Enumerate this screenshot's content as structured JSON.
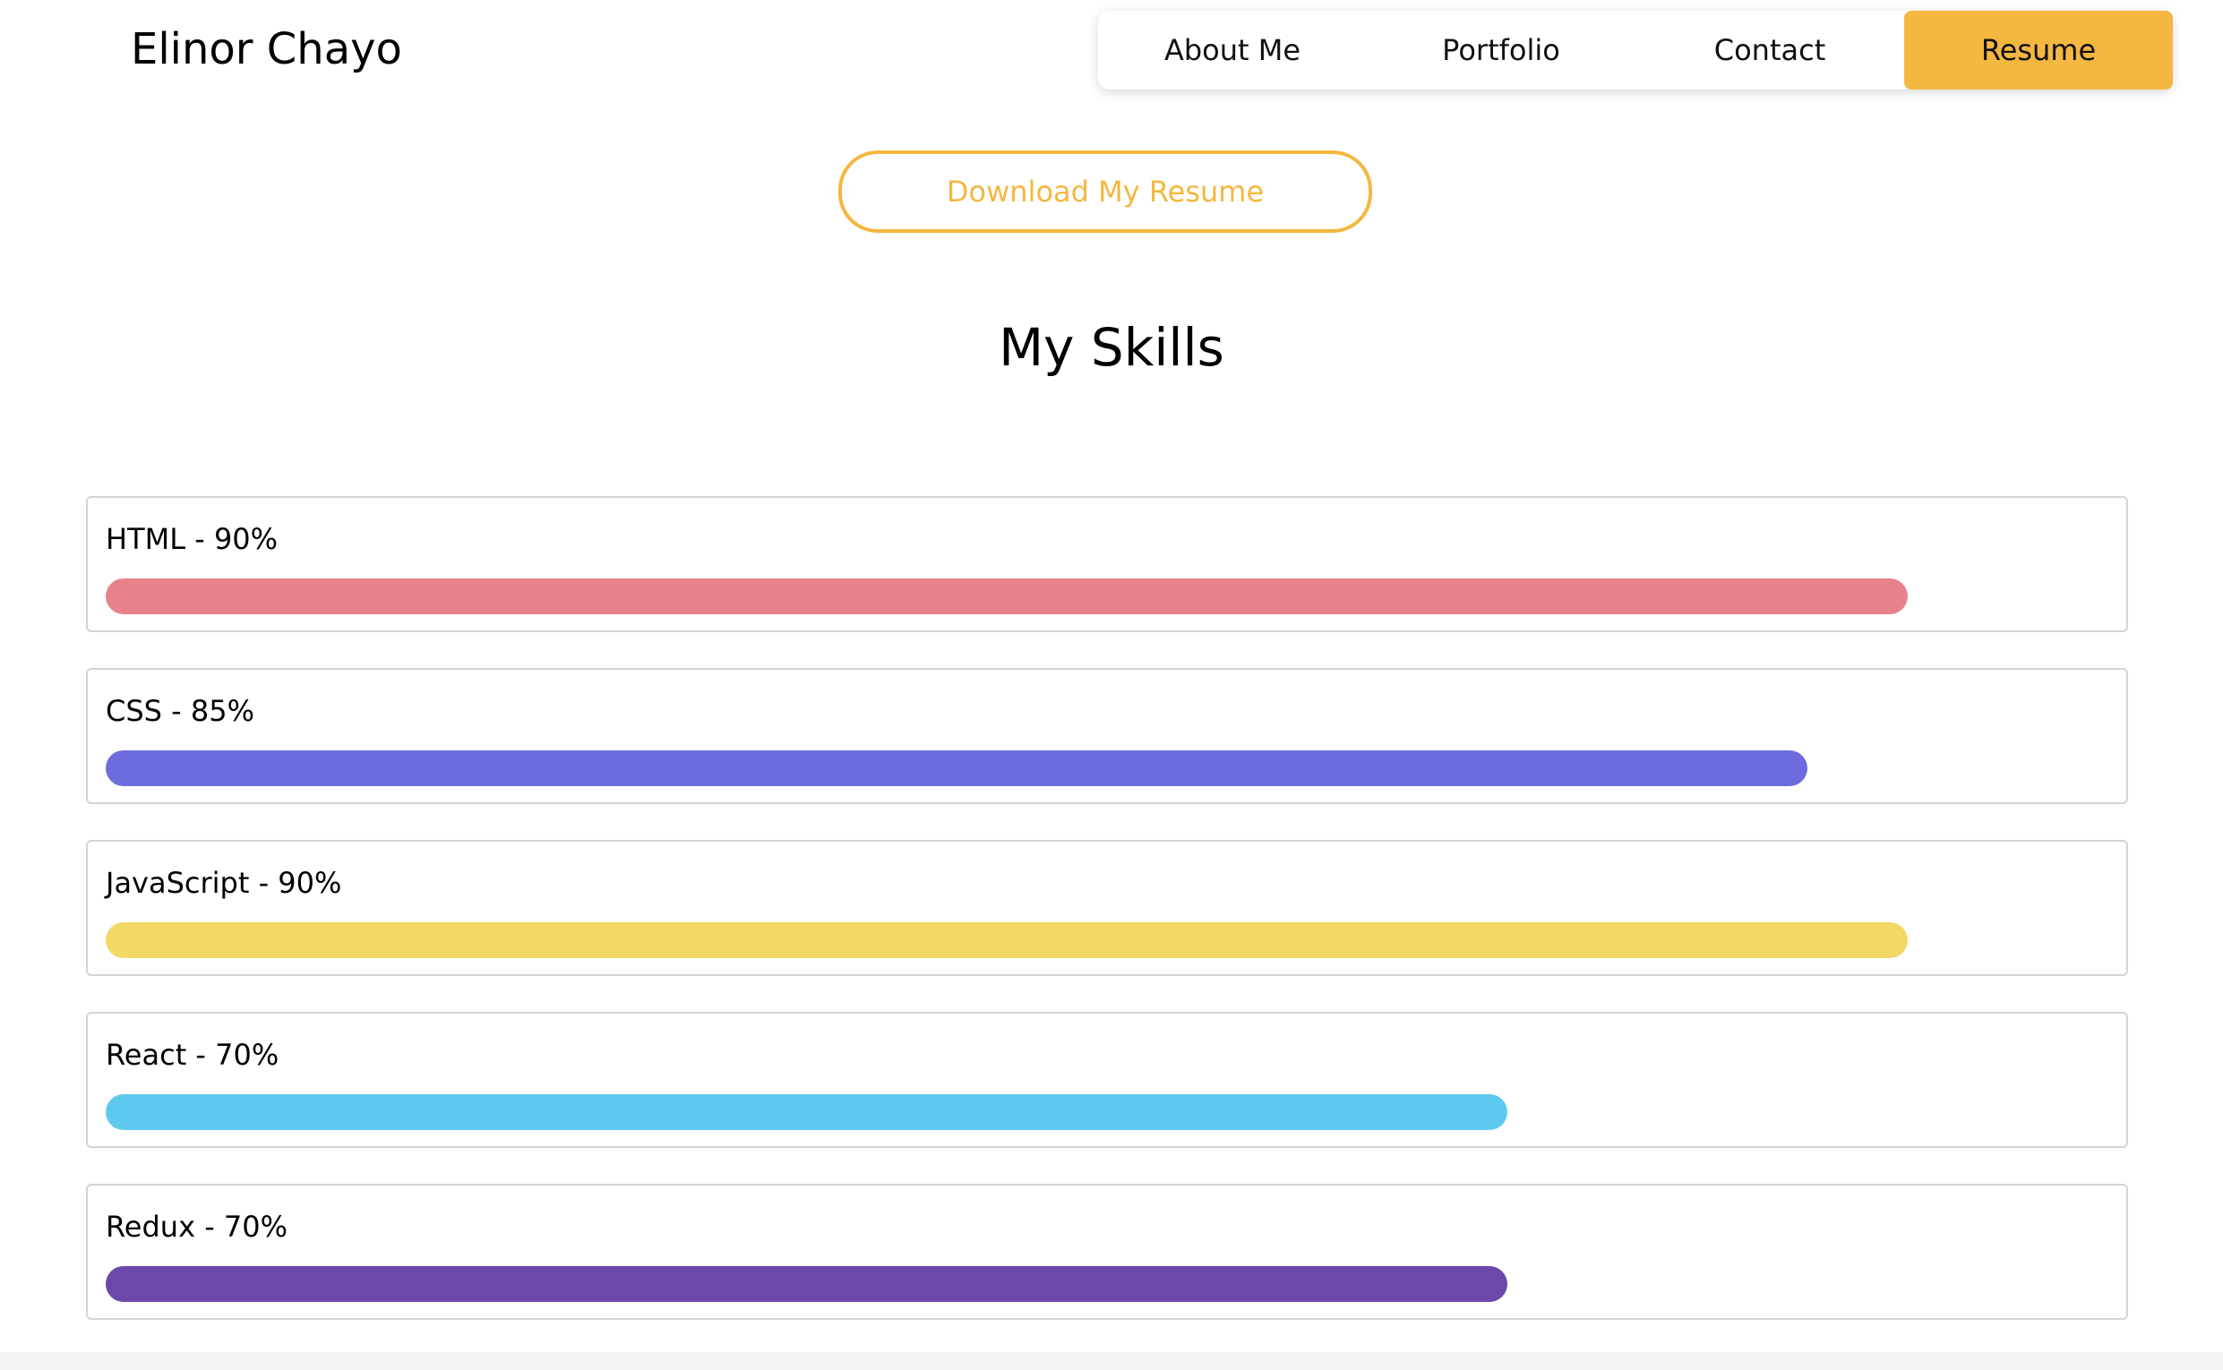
{
  "header": {
    "brand": "Elinor Chayo",
    "nav": [
      {
        "label": "About Me",
        "active": false
      },
      {
        "label": "Portfolio",
        "active": false
      },
      {
        "label": "Contact",
        "active": false
      },
      {
        "label": "Resume",
        "active": true
      }
    ]
  },
  "main": {
    "download_label": "Download My Resume",
    "skills_title": "My Skills",
    "skills": [
      {
        "label": "HTML - 90%",
        "level": 0.9,
        "color": "#e8828a"
      },
      {
        "label": "CSS - 85%",
        "level": 0.85,
        "color": "#6c6cde"
      },
      {
        "label": "JavaScript - 90%",
        "level": 0.9,
        "color": "#f3d865"
      },
      {
        "label": "React - 70%",
        "level": 0.7,
        "color": "#5ec9ee"
      },
      {
        "label": "Redux - 70%",
        "level": 0.7,
        "color": "#6c48ab"
      }
    ]
  },
  "colors": {
    "accent": "#f4b740"
  }
}
